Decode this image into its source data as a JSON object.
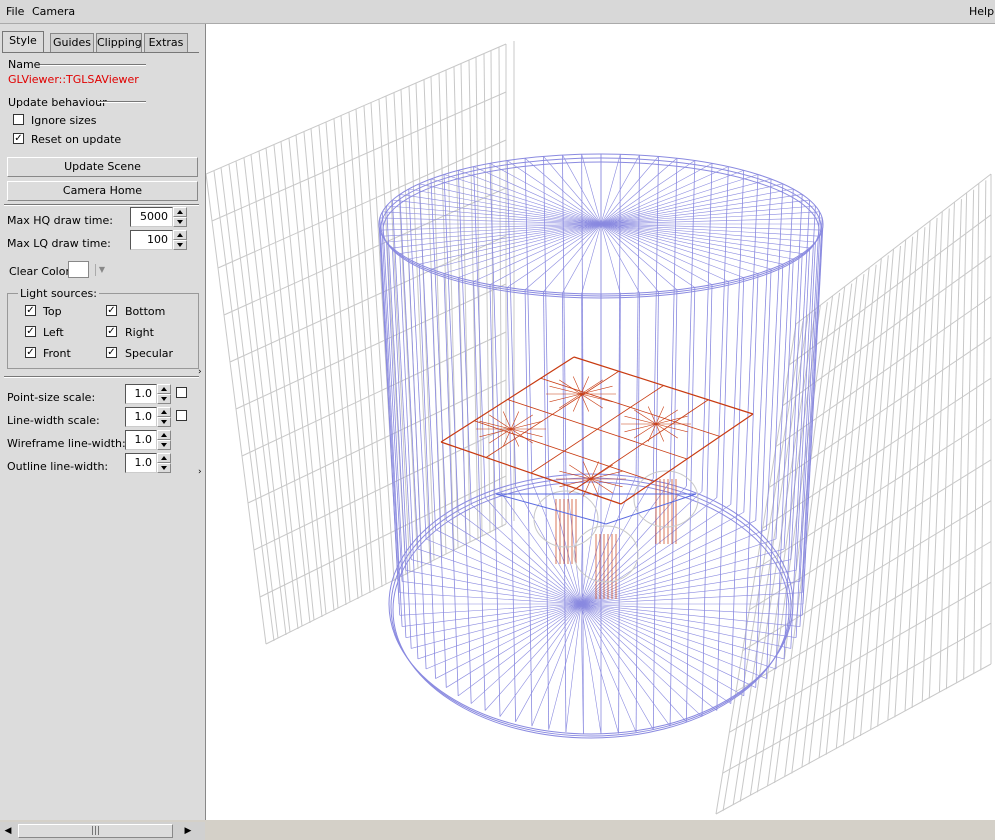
{
  "menu": {
    "file": "File",
    "camera": "Camera",
    "help": "Help"
  },
  "tabs": [
    "Style",
    "Guides",
    "Clipping",
    "Extras"
  ],
  "style": {
    "name_label": "Name",
    "name_value": "GLViewer::TGLSAViewer",
    "name_color": "#e00000",
    "update_behaviour_label": "Update behaviour",
    "ignore_sizes": {
      "label": "Ignore sizes",
      "checked": false
    },
    "reset_on_update": {
      "label": "Reset on update",
      "checked": true
    },
    "update_scene_button": "Update Scene",
    "camera_home_button": "Camera Home",
    "max_hq_label": "Max HQ draw time:",
    "max_hq_value": "5000",
    "max_lq_label": "Max LQ draw time:",
    "max_lq_value": "100",
    "clear_color_label": "Clear Color",
    "clear_color": "#ffffff",
    "light_sources_label": "Light sources:",
    "lights": {
      "top": {
        "label": "Top",
        "checked": true
      },
      "bottom": {
        "label": "Bottom",
        "checked": true
      },
      "left": {
        "label": "Left",
        "checked": true
      },
      "right": {
        "label": "Right",
        "checked": true
      },
      "front": {
        "label": "Front",
        "checked": true
      },
      "specular": {
        "label": "Specular",
        "checked": true
      }
    },
    "point_size_label": "Point-size scale:",
    "point_size_value": "1.0",
    "line_width_label": "Line-width scale:",
    "line_width_value": "1.0",
    "wireframe_label": "Wireframe line-width:",
    "wireframe_value": "1.0",
    "outline_label": "Outline line-width:",
    "outline_value": "1.0"
  },
  "scroll_thumb_glyph": "|||",
  "viewer": {
    "background": "#ffffff",
    "cylinder_color": "#8a8ae0",
    "mesh_color": "#c8c8c8",
    "detector_color": "#c83a10",
    "inner_color": "#5a6ae0"
  }
}
